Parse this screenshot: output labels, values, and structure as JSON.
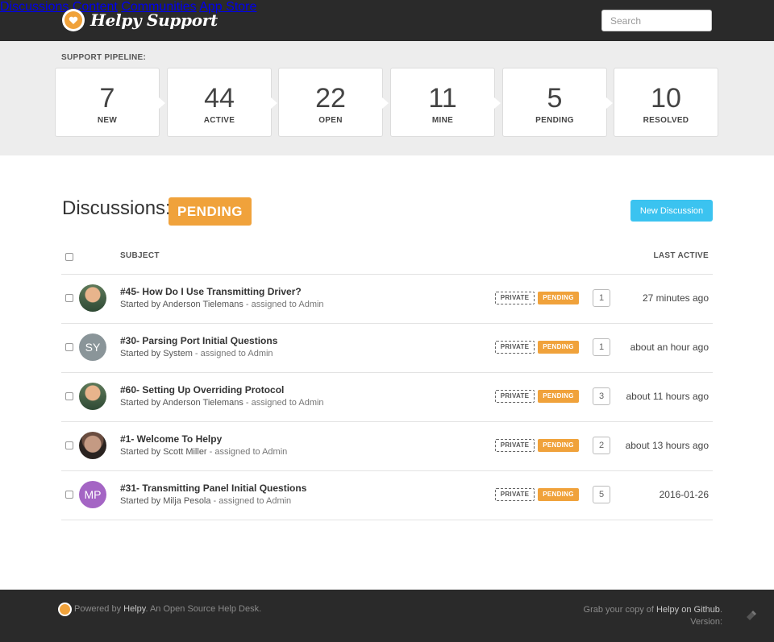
{
  "header": {
    "brand": "Helpy Support",
    "nav": [
      "Discussions",
      "Content",
      "Communities",
      "App Store"
    ],
    "search_placeholder": "Search"
  },
  "pipeline": {
    "label": "SUPPORT PIPELINE:",
    "stages": [
      {
        "count": "7",
        "label": "NEW"
      },
      {
        "count": "44",
        "label": "ACTIVE"
      },
      {
        "count": "22",
        "label": "OPEN"
      },
      {
        "count": "11",
        "label": "MINE"
      },
      {
        "count": "5",
        "label": "PENDING"
      },
      {
        "count": "10",
        "label": "RESOLVED"
      }
    ]
  },
  "discussions": {
    "title": "Discussions:",
    "status": "PENDING",
    "new_button": "New Discussion",
    "columns": {
      "subject": "SUBJECT",
      "last_active": "LAST ACTIVE"
    },
    "rows": [
      {
        "subject": "#45- How Do I Use Transmitting Driver?",
        "started_by": "Started by Anderson Tielemans",
        "assigned": " - assigned to Admin",
        "private": "PRIVATE",
        "status": "PENDING",
        "count": "1",
        "last_active": "27 minutes ago",
        "avatar": "",
        "avatar_color": "photo"
      },
      {
        "subject": "#30- Parsing Port Initial Questions",
        "started_by": "Started by System",
        "assigned": " - assigned to Admin",
        "private": "PRIVATE",
        "status": "PENDING",
        "count": "1",
        "last_active": "about an hour ago",
        "avatar": "SY",
        "avatar_color": "#8a9599"
      },
      {
        "subject": "#60- Setting Up Overriding Protocol",
        "started_by": "Started by Anderson Tielemans",
        "assigned": " - assigned to Admin",
        "private": "PRIVATE",
        "status": "PENDING",
        "count": "3",
        "last_active": "about 11 hours ago",
        "avatar": "",
        "avatar_color": "photo"
      },
      {
        "subject": "#1- Welcome To Helpy",
        "started_by": "Started by Scott Miller",
        "assigned": " - assigned to Admin",
        "private": "PRIVATE",
        "status": "PENDING",
        "count": "2",
        "last_active": "about 13 hours ago",
        "avatar": "",
        "avatar_color": "photo"
      },
      {
        "subject": "#31- Transmitting Panel Initial Questions",
        "started_by": "Started by Milja Pesola",
        "assigned": " - assigned to Admin",
        "private": "PRIVATE",
        "status": "PENDING",
        "count": "5",
        "last_active": "2016-01-26",
        "avatar": "MP",
        "avatar_color": "#a465c4"
      }
    ]
  },
  "footer": {
    "powered_prefix": "Powered by ",
    "powered_link": "Helpy",
    "powered_suffix": ". An Open Source Help Desk.",
    "grab_prefix": "Grab your copy of ",
    "grab_link": "Helpy on Github",
    "grab_suffix": ".",
    "version_label": "Version:"
  },
  "colors": {
    "accent_orange": "#f0a23b",
    "button_blue": "#3bc3f0",
    "topbar": "#2a2a2a"
  }
}
